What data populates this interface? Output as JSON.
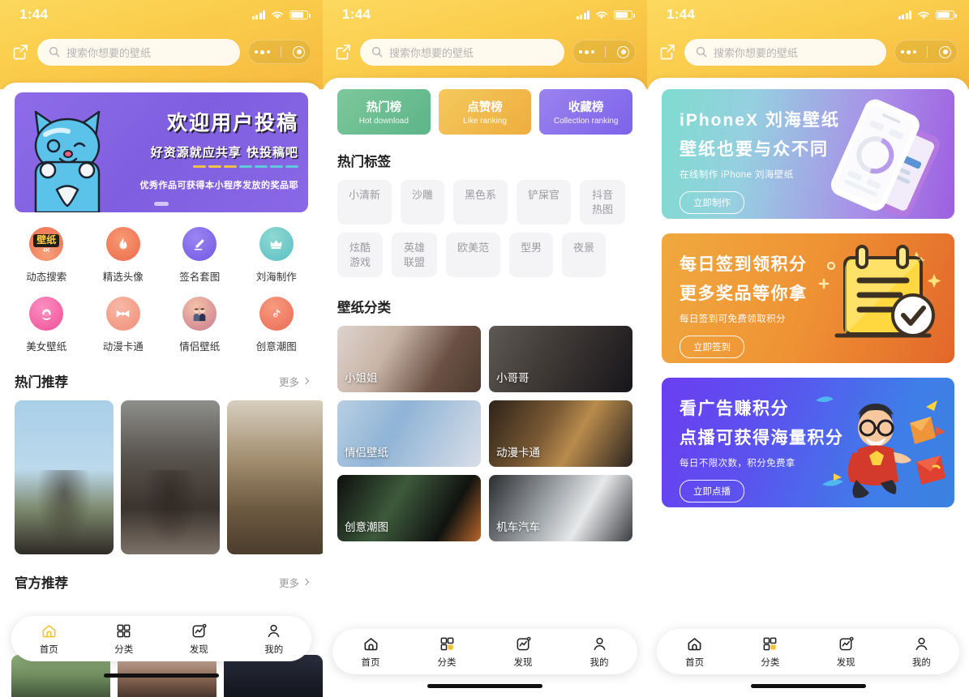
{
  "status_bar": {
    "time": "1:44",
    "signal_icon": "cellular-bars-icon",
    "wifi_icon": "wifi-icon",
    "battery_icon": "battery-icon"
  },
  "nav": {
    "share_icon": "share-icon",
    "search_icon": "search-icon",
    "search_placeholder": "搜索你想要的壁纸",
    "search_value": "",
    "capsule_more_icon": "more-dots-icon",
    "capsule_target_icon": "target-circle-icon"
  },
  "panel1": {
    "promo": {
      "title": "欢迎用户投稿",
      "subtitle": "好资源就应共享  快投稿吧",
      "footnote": "优秀作品可获得本小程序发放的奖品耶",
      "mascot_icon": "blue-cat-mascot-icon",
      "bg_color": "#8a68e6",
      "rule_colors": [
        "#f0c04a",
        "#f0c04a",
        "#f0c04a",
        "#5fc9d9",
        "#5fc9d9",
        "#5fc9d9",
        "#5fc9d9"
      ]
    },
    "quick_entries": [
      {
        "label": "动态搜索",
        "icon": "wallpaper-4k-badge-icon",
        "badge_title": "壁纸",
        "badge_sub": "4K",
        "color": "#ef7f5e"
      },
      {
        "label": "精选头像",
        "icon": "flame-icon",
        "glyph": "🔥",
        "color": "#ef6d4f"
      },
      {
        "label": "签名套图",
        "icon": "pencil-edit-icon",
        "glyph": "✎",
        "color": "#7b61e8"
      },
      {
        "label": "刘海制作",
        "icon": "diy-crown-icon",
        "glyph": "♛",
        "color": "#5fc6c6"
      },
      {
        "label": "美女壁纸",
        "icon": "girl-avatar-icon",
        "glyph": "👧",
        "color": "#ef5f9e"
      },
      {
        "label": "动漫卡通",
        "icon": "ribbon-bow-icon",
        "glyph": "🎀",
        "color": "#f09a87"
      },
      {
        "label": "情侣壁纸",
        "icon": "couple-icon",
        "glyph": "👫",
        "color": "#e7618f"
      },
      {
        "label": "创意潮图",
        "icon": "tiktok-note-icon",
        "glyph": "♪",
        "color": "#ef7a66"
      }
    ],
    "hot_section": {
      "title": "热门推荐",
      "more": "更多",
      "more_icon": "chevron-right-icon"
    },
    "official_section": {
      "title": "官方推荐",
      "more": "更多",
      "more_icon": "chevron-right-icon"
    },
    "hot_cards": [
      {
        "name": "school-girl-blue-sky-photo"
      },
      {
        "name": "long-hair-girl-tank-top-photo"
      },
      {
        "name": "plaid-skirt-camera-photo"
      },
      {
        "name": "partial-photo"
      }
    ],
    "official_cards": [
      {
        "name": "green-window-photo"
      },
      {
        "name": "hair-closeup-photo"
      },
      {
        "name": "dark-navy-photo"
      }
    ]
  },
  "panel2": {
    "rankings": [
      {
        "cn": "热门榜",
        "en": "Hot download",
        "color": "#5bb588"
      },
      {
        "cn": "点赞榜",
        "en": "Like ranking",
        "color": "#eead3e"
      },
      {
        "cn": "收藏榜",
        "en": "Collection ranking",
        "color": "#7d63ea"
      }
    ],
    "hot_tags_title": "热门标签",
    "hot_tags": [
      "小清新",
      "沙雕",
      "黑色系",
      "铲屎官",
      "抖音热图",
      "炫酷游戏",
      "英雄联盟",
      "欧美范",
      "型男",
      "夜景"
    ],
    "category_title": "壁纸分类",
    "categories": [
      {
        "label": "小姐姐",
        "icon": "girl-portrait-thumb"
      },
      {
        "label": "小哥哥",
        "icon": "boy-portrait-thumb"
      },
      {
        "label": "情侣壁纸",
        "icon": "couple-wallpaper-thumb"
      },
      {
        "label": "动漫卡通",
        "icon": "anime-thumb"
      },
      {
        "label": "创意潮图",
        "icon": "creative-thumb"
      },
      {
        "label": "机车汽车",
        "icon": "car-thumb"
      }
    ]
  },
  "panel3": {
    "banners": [
      {
        "title": "iPhoneX 刘海壁纸",
        "title2": "壁纸也要与众不同",
        "subtitle": "在线制作 iPhone 刘海壁纸",
        "button": "立即制作",
        "art_icon": "phone-mockup-icon",
        "color": "#8fd6d4"
      },
      {
        "title": "每日签到领积分",
        "title2": "更多奖品等你拿",
        "subtitle": "每日签到可免费领取积分",
        "button": "立即签到",
        "art_icon": "calendar-check-icon",
        "color": "#ef9234"
      },
      {
        "title": "看广告赚积分",
        "title2": "点播可获得海量积分",
        "subtitle": "每日不限次数，积分免费拿",
        "button": "立即点播",
        "art_icon": "superhero-icon",
        "color": "#5b52ef"
      }
    ]
  },
  "tabbar": {
    "items": [
      {
        "label": "首页",
        "icon": "home-icon"
      },
      {
        "label": "分类",
        "icon": "grid-categories-icon"
      },
      {
        "label": "发现",
        "icon": "discover-chart-icon"
      },
      {
        "label": "我的",
        "icon": "person-profile-icon"
      }
    ],
    "active_panel1": 0,
    "active_panel2": 1,
    "active_panel3": 1,
    "accent_color": "#f2c230"
  }
}
